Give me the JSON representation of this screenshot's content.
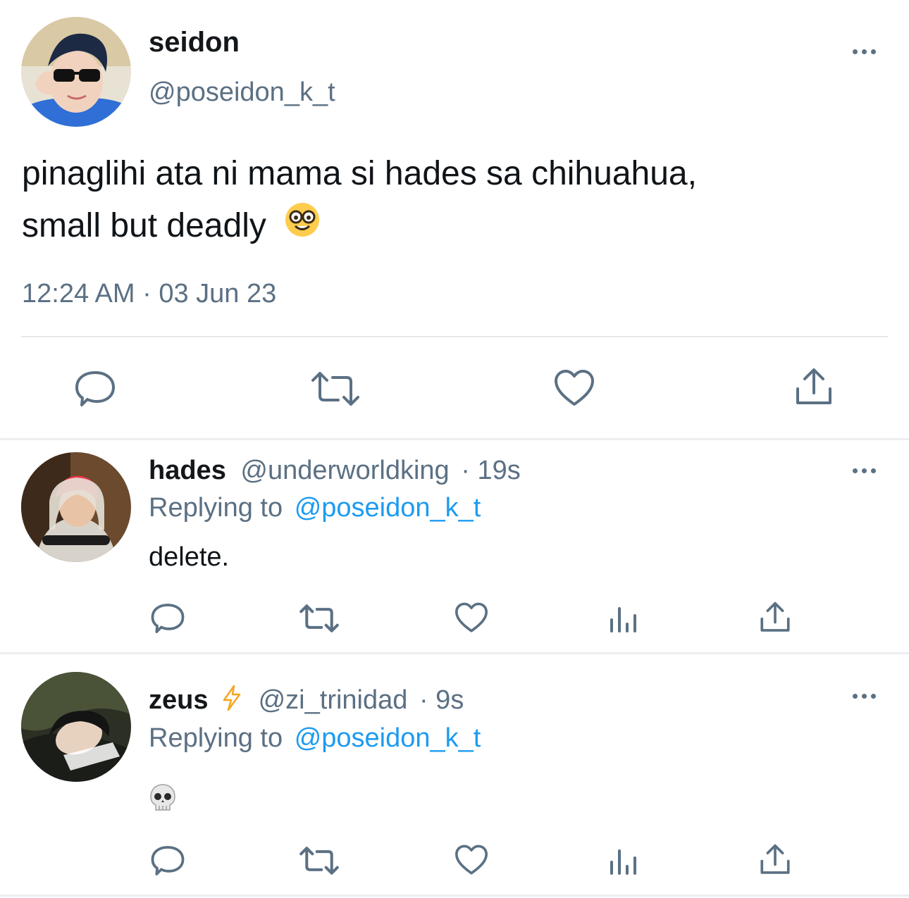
{
  "main_tweet": {
    "display_name": "seidon",
    "handle": "@poseidon_k_t",
    "text_line1": "pinaglihi ata ni mama si hades sa chihuahua,",
    "text_line2": "small but deadly",
    "text_emoji": "nerd-face-emoji",
    "timestamp": "12:24 AM · 03 Jun 23",
    "actions": [
      "reply-icon",
      "retweet-icon",
      "like-icon",
      "share-icon"
    ]
  },
  "replies": [
    {
      "display_name": "hades",
      "handle": "@underworldking",
      "time": "· 19s",
      "replying_label": "Replying to",
      "replying_to": "@poseidon_k_t",
      "text": "delete.",
      "actions": [
        "reply-icon",
        "retweet-icon",
        "like-icon",
        "analytics-icon",
        "share-icon"
      ]
    },
    {
      "display_name": "zeus",
      "name_emoji": "lightning-emoji",
      "handle": "@zi_trinidad",
      "time": "· 9s",
      "replying_label": "Replying to",
      "replying_to": "@poseidon_k_t",
      "text_emoji": "skull-emoji",
      "actions": [
        "reply-icon",
        "retweet-icon",
        "like-icon",
        "analytics-icon",
        "share-icon"
      ]
    }
  ],
  "colors": {
    "link": "#1d9bf0",
    "muted": "#5b7083",
    "divider": "#eceef0",
    "lightning": "#f5a623"
  }
}
